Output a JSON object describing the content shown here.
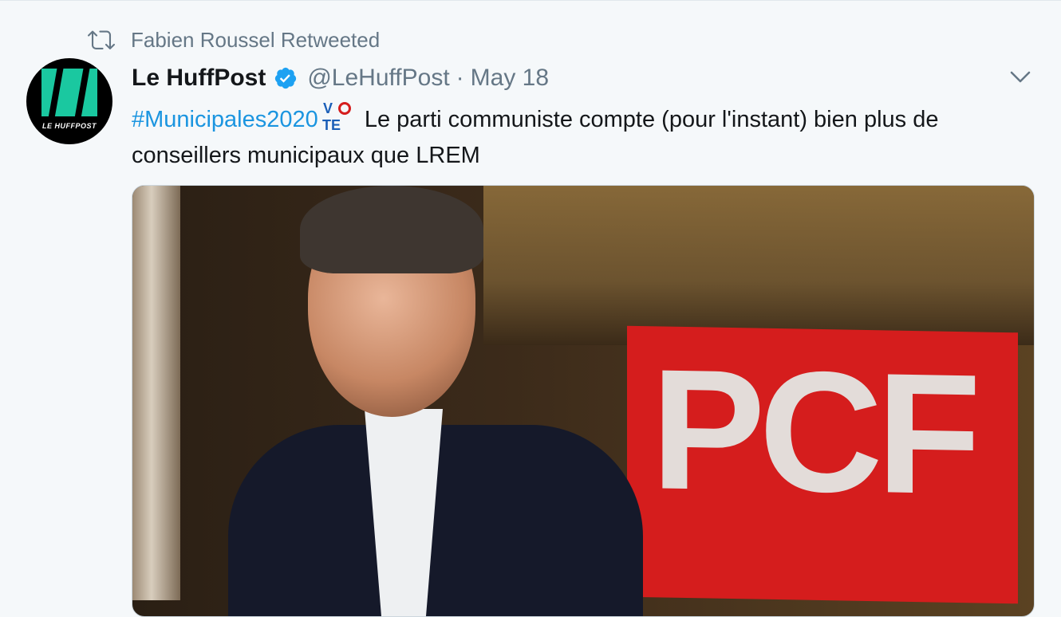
{
  "retweet": {
    "label": "Fabien Roussel Retweeted"
  },
  "tweet": {
    "author_name": "Le HuffPost",
    "handle": "@LeHuffPost",
    "separator": "·",
    "date": "May 18",
    "hashtag": "#Municipales2020",
    "emoji": "vote-box-icon",
    "text": "Le parti communiste compte (pour l'instant) bien plus de conseillers municipaux que LREM"
  },
  "avatar": {
    "wordmark": "LE HUFFPOST"
  },
  "media": {
    "banner_text": "PCF"
  },
  "colors": {
    "link": "#1b95e0",
    "muted": "#657786",
    "background": "#f5f8fa",
    "huffpost_green": "#1ac8a0"
  }
}
